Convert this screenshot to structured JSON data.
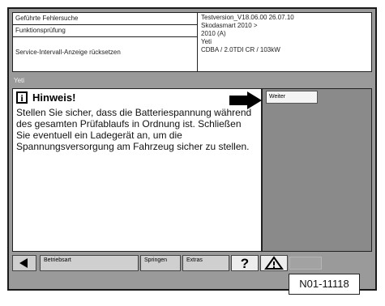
{
  "header": {
    "left_rows": [
      "Geführte Fehlersuche",
      "Funktionsprüfung",
      "Service-Intervall-Anzeige rücksetzen"
    ],
    "right_lines": [
      "Testversion_V18.06.00 26.07.10",
      "Skodasmart 2010 >",
      "2010 (A)",
      "Yeti",
      "CDBA / 2.0TDI CR / 103kW"
    ]
  },
  "subtitle": "Yeti",
  "note": {
    "icon": "info-icon",
    "title": "Hinweis!",
    "text": "Stellen Sie sicher, dass die Batteriespannung während des gesamten Prüfablaufs in Ordnung ist. Schließen Sie eventuell ein Ladegerät an, um die Spannungsversorgung am Fahrzeug sicher zu stellen."
  },
  "right_panel": {
    "button_label": "Weiter"
  },
  "toolbar": {
    "back_icon": "triangle-left-icon",
    "btn_modes": "Betriebsart",
    "btn_jump": "Springen",
    "btn_extra": "Extras",
    "help_label": "?",
    "warn_icon": "warning-triangle-icon"
  },
  "reference": "N01-11118"
}
